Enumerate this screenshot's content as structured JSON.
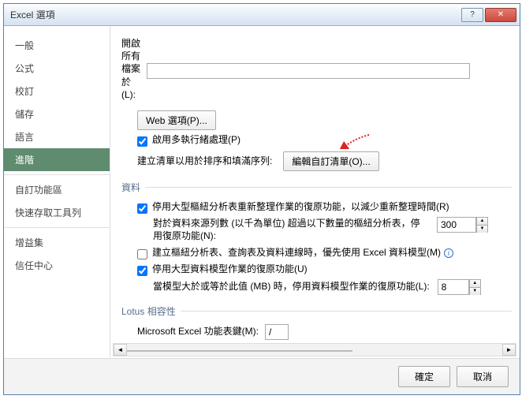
{
  "window": {
    "title": "Excel 選項"
  },
  "sidebar": {
    "items": [
      "一般",
      "公式",
      "校訂",
      "儲存",
      "語言",
      "進階",
      "自訂功能區",
      "快速存取工具列",
      "增益集",
      "信任中心"
    ],
    "active_index": 5
  },
  "content": {
    "open_all_files_label": "開啟\n所有\n檔案\n於\n(L):",
    "web_options_btn": "Web 選項(P)...",
    "multithread_label": "啟用多執行緒處理(P)",
    "custom_list_desc": "建立清單以用於排序和填滿序列:",
    "edit_custom_list_btn": "編輯自訂清單(O)...",
    "section_data": "資料",
    "disable_undo_pivot": "停用大型樞紐分析表重新整理作業的復原功能，以減少重新整理時間(R)",
    "pivot_threshold_label": "對於資料來源列數 (以千為單位) 超過以下數量的樞紐分析表，停用復原功能(N):",
    "pivot_threshold_value": "300",
    "prefer_datamodel": "建立樞紐分析表、查詢表及資料連線時，優先使用 Excel 資料模型(M)",
    "disable_undo_datamodel": "停用大型資料模型作業的復原功能(U)",
    "datamodel_mb_label": "當模型大於或等於此值 (MB) 時，停用資料模型作業的復原功能(L):",
    "datamodel_mb_value": "8",
    "section_lotus": "Lotus 相容性",
    "lotus_keys_label": "Microsoft Excel 功能表鍵(M):",
    "lotus_keys_value": "/"
  },
  "footer": {
    "ok": "確定",
    "cancel": "取消"
  }
}
